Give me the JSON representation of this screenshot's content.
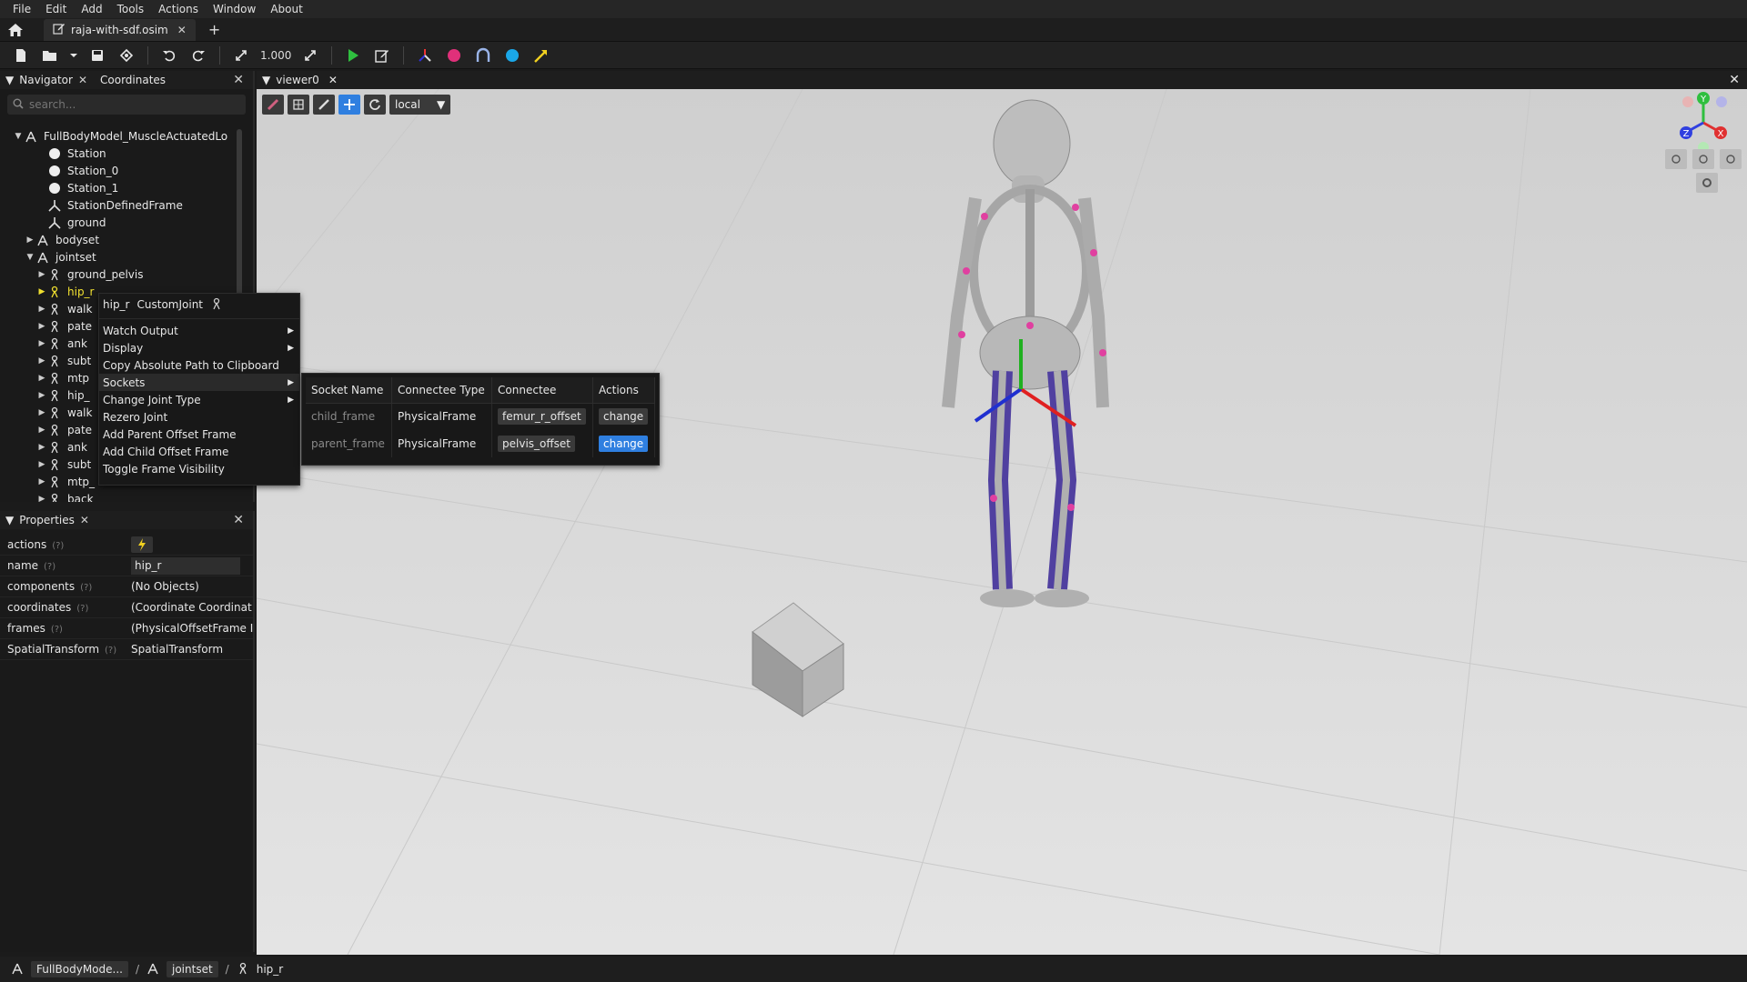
{
  "menubar": [
    "File",
    "Edit",
    "Add",
    "Tools",
    "Actions",
    "Window",
    "About"
  ],
  "tabs": {
    "file_tab": "raja-with-sdf.osim"
  },
  "toolbar": {
    "zoom_value": "1.000"
  },
  "navigator": {
    "tab_navigator": "Navigator",
    "tab_coordinates": "Coordinates",
    "search_placeholder": "search...",
    "tree": [
      {
        "label": "FullBodyModel_MuscleActuatedLo",
        "icon": "model-icon",
        "arrow": "▼",
        "indent": 0
      },
      {
        "label": "Station",
        "icon": "station-icon",
        "arrow": "",
        "indent": 2
      },
      {
        "label": "Station_0",
        "icon": "station-icon",
        "arrow": "",
        "indent": 2
      },
      {
        "label": "Station_1",
        "icon": "station-icon",
        "arrow": "",
        "indent": 2
      },
      {
        "label": "StationDefinedFrame",
        "icon": "frame-icon",
        "arrow": "",
        "indent": 2
      },
      {
        "label": "ground",
        "icon": "frame-icon",
        "arrow": "",
        "indent": 2
      },
      {
        "label": "bodyset",
        "icon": "set-icon",
        "arrow": "▶",
        "indent": 1
      },
      {
        "label": "jointset",
        "icon": "set-icon",
        "arrow": "▼",
        "indent": 1
      },
      {
        "label": "ground_pelvis",
        "icon": "joint-icon",
        "arrow": "▶",
        "indent": 2
      },
      {
        "label": "hip_r",
        "icon": "joint-icon",
        "arrow": "▶",
        "indent": 2
      },
      {
        "label": "walk",
        "icon": "joint-icon",
        "arrow": "▶",
        "indent": 2
      },
      {
        "label": "pate",
        "icon": "joint-icon",
        "arrow": "▶",
        "indent": 2
      },
      {
        "label": "ank",
        "icon": "joint-icon",
        "arrow": "▶",
        "indent": 2
      },
      {
        "label": "subt",
        "icon": "joint-icon",
        "arrow": "▶",
        "indent": 2
      },
      {
        "label": "mtp",
        "icon": "joint-icon",
        "arrow": "▶",
        "indent": 2
      },
      {
        "label": "hip_",
        "icon": "joint-icon",
        "arrow": "▶",
        "indent": 2
      },
      {
        "label": "walk",
        "icon": "joint-icon",
        "arrow": "▶",
        "indent": 2
      },
      {
        "label": "pate",
        "icon": "joint-icon",
        "arrow": "▶",
        "indent": 2
      },
      {
        "label": "ank",
        "icon": "joint-icon",
        "arrow": "▶",
        "indent": 2
      },
      {
        "label": "subt",
        "icon": "joint-icon",
        "arrow": "▶",
        "indent": 2
      },
      {
        "label": "mtp_",
        "icon": "joint-icon",
        "arrow": "▶",
        "indent": 2
      },
      {
        "label": "back",
        "icon": "joint-icon",
        "arrow": "▶",
        "indent": 2
      }
    ]
  },
  "properties": {
    "title": "Properties",
    "rows": [
      {
        "key": "actions",
        "value": "",
        "kind": "action"
      },
      {
        "key": "name",
        "value": "hip_r",
        "kind": "input"
      },
      {
        "key": "components",
        "value": "(No Objects)",
        "kind": "text"
      },
      {
        "key": "coordinates",
        "value": "(Coordinate Coordinat",
        "kind": "text"
      },
      {
        "key": "frames",
        "value": "(PhysicalOffsetFrame I",
        "kind": "text"
      },
      {
        "key": "SpatialTransform",
        "value": "SpatialTransform",
        "kind": "text"
      }
    ],
    "help": "(?)"
  },
  "context_menu": {
    "title_name": "hip_r",
    "title_type": "CustomJoint",
    "items": [
      {
        "label": "Watch Output",
        "submenu": true
      },
      {
        "label": "Display",
        "submenu": true
      },
      {
        "label": "Copy Absolute Path to Clipboard",
        "submenu": false
      },
      {
        "label": "Sockets",
        "submenu": true,
        "active": true
      },
      {
        "label": "Change Joint Type",
        "submenu": true
      },
      {
        "label": "Rezero Joint",
        "submenu": false
      },
      {
        "label": "Add Parent Offset Frame",
        "submenu": false
      },
      {
        "label": "Add Child Offset Frame",
        "submenu": false
      },
      {
        "label": "Toggle Frame Visibility",
        "submenu": false
      }
    ]
  },
  "sockets": {
    "headers": [
      "Socket Name",
      "Connectee Type",
      "Connectee",
      "Actions"
    ],
    "rows": [
      {
        "name": "child_frame",
        "type": "PhysicalFrame",
        "connectee": "femur_r_offset",
        "action": "change",
        "highlight": false
      },
      {
        "name": "parent_frame",
        "type": "PhysicalFrame",
        "connectee": "pelvis_offset",
        "action": "change",
        "highlight": true
      }
    ]
  },
  "viewer": {
    "tab": "viewer0",
    "frame_mode": "local",
    "gizmo_axes": [
      "Y",
      "X",
      "Z"
    ]
  },
  "statusbar": {
    "crumbs": [
      "FullBodyMode...",
      "jointset",
      "hip_r"
    ]
  },
  "colors": {
    "accent": "#2f7fe0",
    "highlight_text": "#f0e030",
    "viewer_bg": "#d9d9d9"
  }
}
